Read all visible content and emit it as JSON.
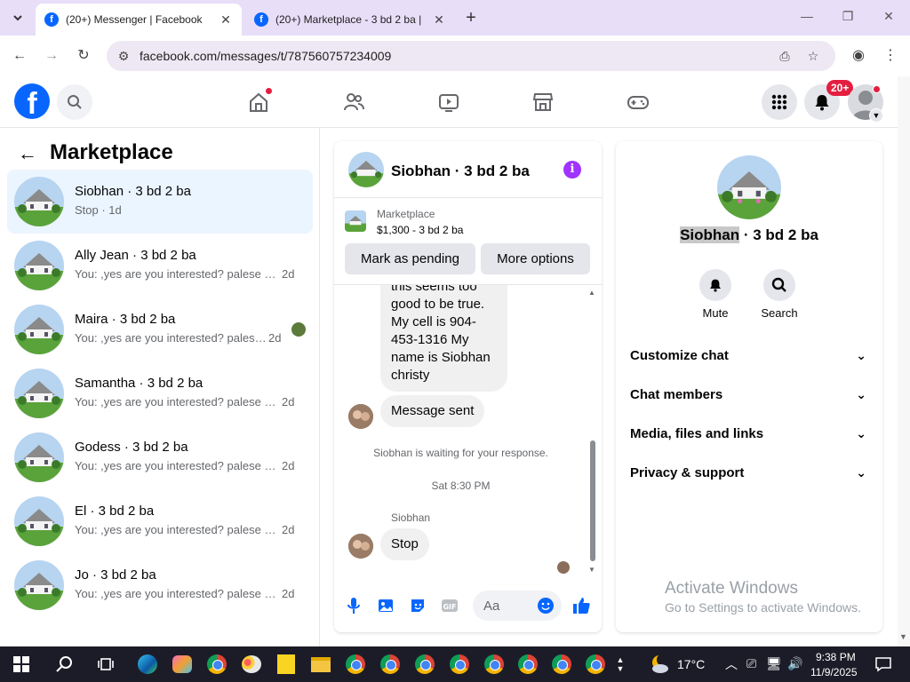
{
  "browser": {
    "tabs": [
      {
        "title": "(20+) Messenger | Facebook",
        "active": true
      },
      {
        "title": "(20+) Marketplace - 3 bd 2 ba |",
        "active": false
      }
    ],
    "url": "facebook.com/messages/t/787560757234009"
  },
  "header": {
    "logo": "f",
    "notification_badge": "20+"
  },
  "sidebar": {
    "title": "Marketplace",
    "conversations": [
      {
        "name": "Siobhan · 3 bd 2 ba",
        "preview": "Stop · 1d",
        "time": "",
        "active": true
      },
      {
        "name": "Ally Jean · 3 bd 2 ba",
        "preview": "You: ,yes are you interested? palese a...",
        "time": "2d"
      },
      {
        "name": "Maira · 3 bd 2 ba",
        "preview": "You: ,yes are you interested? palese...",
        "time": "2d"
      },
      {
        "name": "Samantha · 3 bd 2 ba",
        "preview": "You: ,yes are you interested? palese a...",
        "time": "2d"
      },
      {
        "name": "Godess · 3 bd 2 ba",
        "preview": "You: ,yes are you interested? palese a...",
        "time": "2d"
      },
      {
        "name": "El · 3 bd 2 ba",
        "preview": "You: ,yes are you interested? palese a...",
        "time": "2d"
      },
      {
        "name": "Jo · 3 bd 2 ba",
        "preview": "You: ,yes are you interested? palese a...",
        "time": "2d"
      }
    ]
  },
  "chat": {
    "title": "Siobhan · 3 bd 2 ba",
    "marketplace_label": "Marketplace",
    "listing": "$1,300 - 3 bd 2 ba",
    "mark_pending": "Mark as pending",
    "more_options": "More options",
    "messages": {
      "m1": "this seems too good to be true. My cell is 904-453-1316 My name is Siobhan christy",
      "m2": "Message sent",
      "waiting": "Siobhan is waiting for your response.",
      "timestamp": "Sat 8:30 PM",
      "sender": "Siobhan",
      "m3": "Stop"
    },
    "composer_placeholder": "Aa"
  },
  "details": {
    "name_highlight": "Siobhan",
    "name_rest": " · 3 bd 2 ba",
    "mute": "Mute",
    "search": "Search",
    "sections": [
      "Customize chat",
      "Chat members",
      "Media, files and links",
      "Privacy & support"
    ]
  },
  "watermark": {
    "line1": "Activate Windows",
    "line2": "Go to Settings to activate Windows."
  },
  "taskbar": {
    "weather": "17°C",
    "time": "9:38 PM",
    "date": "11/9/2025"
  },
  "colors": {
    "fb_blue": "#0866ff",
    "active_conv": "#ebf5ff",
    "info_purple": "#a033ff",
    "notif_red": "#e41e3f"
  }
}
